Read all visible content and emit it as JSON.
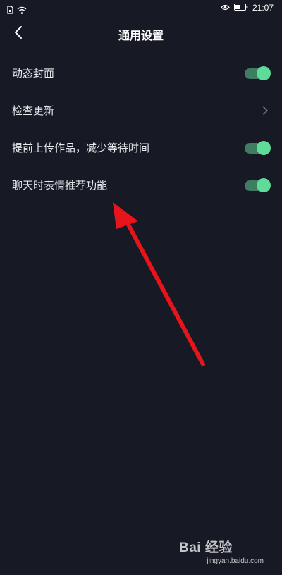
{
  "status_bar": {
    "time": "21:07",
    "icons": [
      "sim-icon",
      "wifi-icon",
      "eye-icon",
      "battery-icon"
    ]
  },
  "header": {
    "title": "通用设置",
    "back_icon": "back-arrow-icon"
  },
  "settings": [
    {
      "label": "动态封面",
      "control": "toggle",
      "on": true
    },
    {
      "label": "检查更新",
      "control": "chevron"
    },
    {
      "label": "提前上传作品，减少等待时间",
      "control": "toggle",
      "on": true
    },
    {
      "label": "聊天时表情推荐功能",
      "control": "toggle",
      "on": true
    }
  ],
  "colors": {
    "background": "#171a24",
    "toggle_track": "#3f7d63",
    "toggle_knob": "#5fdc9a",
    "annotation_arrow": "#e8141b"
  },
  "watermark": {
    "logo": "Bai 经验",
    "url": "jingyan.baidu.com"
  }
}
